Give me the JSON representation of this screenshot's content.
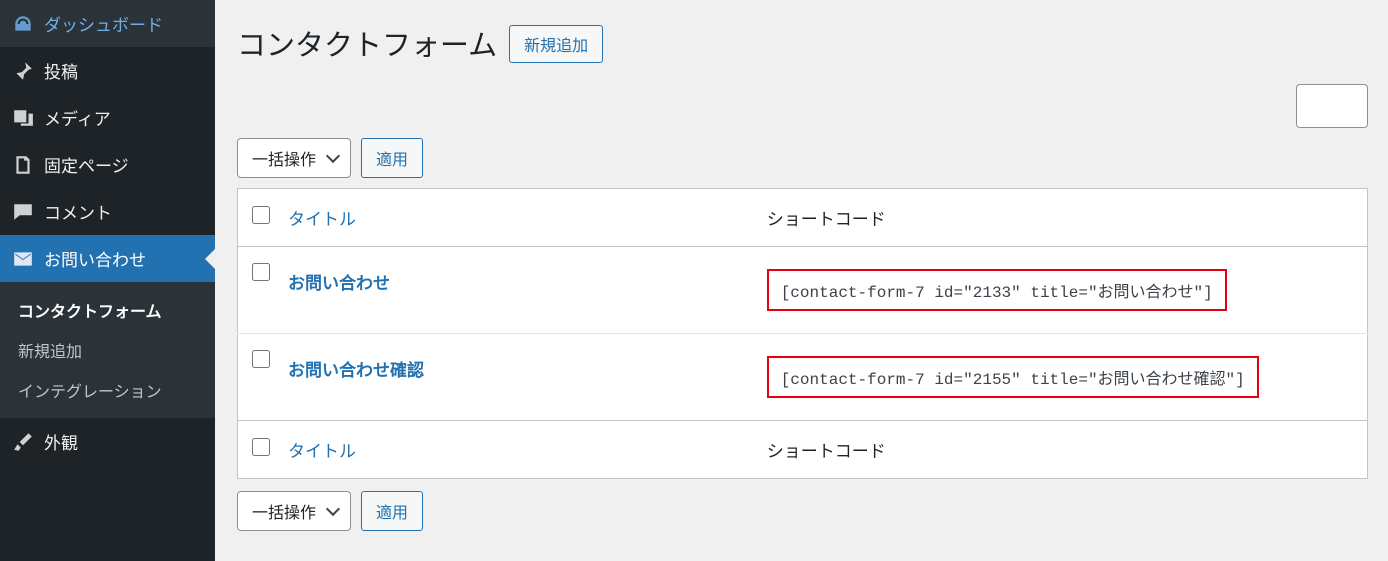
{
  "sidebar": {
    "items": [
      {
        "label": "ダッシュボード",
        "icon": "dashboard"
      },
      {
        "label": "投稿",
        "icon": "pin"
      },
      {
        "label": "メディア",
        "icon": "media"
      },
      {
        "label": "固定ページ",
        "icon": "page"
      },
      {
        "label": "コメント",
        "icon": "comment"
      },
      {
        "label": "お問い合わせ",
        "icon": "mail",
        "current": true
      },
      {
        "label": "外観",
        "icon": "brush"
      }
    ],
    "submenu": [
      {
        "label": "コンタクトフォーム",
        "current": true
      },
      {
        "label": "新規追加"
      },
      {
        "label": "インテグレーション"
      }
    ]
  },
  "header": {
    "title": "コンタクトフォーム",
    "add_new": "新規追加"
  },
  "bulk": {
    "label": "一括操作",
    "apply": "適用"
  },
  "table": {
    "col_title": "タイトル",
    "col_shortcode": "ショートコード",
    "rows": [
      {
        "title": "お問い合わせ",
        "shortcode": "[contact-form-7 id=\"2133\" title=\"お問い合わせ\"]"
      },
      {
        "title": "お問い合わせ確認",
        "shortcode": "[contact-form-7 id=\"2155\" title=\"お問い合わせ確認\"]"
      }
    ]
  }
}
